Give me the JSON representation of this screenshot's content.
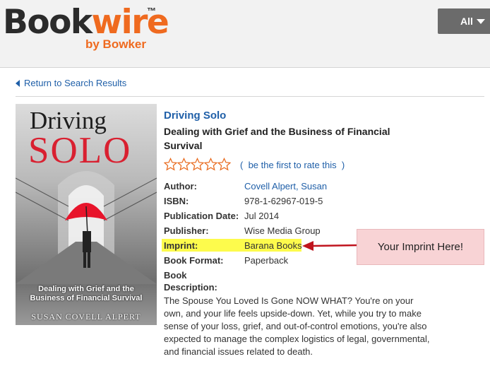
{
  "header": {
    "logo_main_dark": "Book",
    "logo_main_accent": "wire",
    "logo_tm": "™",
    "logo_sub": "by Bowker",
    "category_button": "All"
  },
  "nav": {
    "back_label": "Return to Search Results"
  },
  "book": {
    "cover": {
      "title_top": "Driving",
      "title_big": "SOLO",
      "subtitle_line1": "Dealing with Grief and the",
      "subtitle_line2": "Business of Financial Survival",
      "author": "SUSAN COVELL ALPERT"
    },
    "title": "Driving Solo",
    "subtitle": "Dealing with Grief and the Business of Financial Survival",
    "rating": {
      "stars_filled": 0,
      "stars_total": 5,
      "prompt_open": "(",
      "prompt": "be the first to rate this",
      "prompt_close": ")"
    },
    "fields": {
      "author_label": "Author:",
      "author_value": "Covell Alpert, Susan",
      "isbn_label": "ISBN:",
      "isbn_value": "978-1-62967-019-5",
      "pubdate_label": "Publication Date:",
      "pubdate_value": "Jul 2014",
      "publisher_label": "Publisher:",
      "publisher_value": "Wise Media Group",
      "imprint_label": "Imprint:",
      "imprint_value": "Barana Books",
      "format_label": "Book Format:",
      "format_value": "Paperback",
      "description_label_1": "Book",
      "description_label_2": "Description:"
    },
    "description": "The Spouse You Loved Is Gone NOW WHAT? You're on your own, and your life feels upside-down. Yet, while you try to make sense of your loss, grief, and out-of-control emotions, you're also expected to manage the complex logistics of legal, governmental, and financial issues related to death."
  },
  "annotation": {
    "callout_text": "Your Imprint Here!"
  },
  "colors": {
    "brand_orange": "#ef6a1f",
    "link_blue": "#1f5fa8",
    "highlight_yellow": "#fdfb4c",
    "callout_pink": "#f8d3d5",
    "arrow_red": "#c0141e",
    "star_outline": "#e8691c"
  }
}
